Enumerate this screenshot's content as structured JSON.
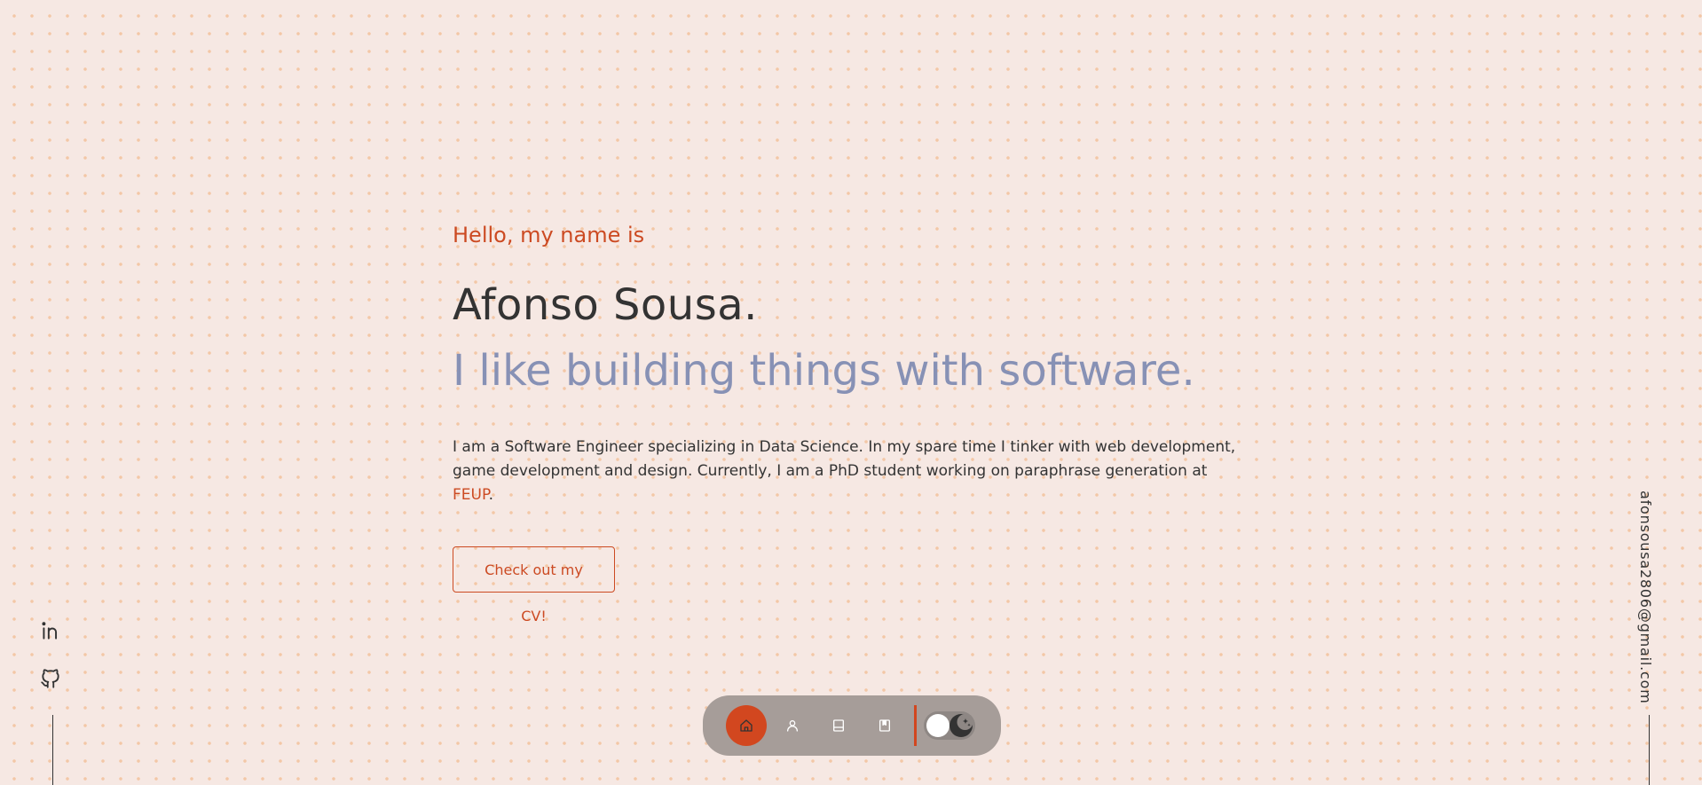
{
  "hero": {
    "greeting": "Hello, my name is",
    "name": "Afonso Sousa.",
    "tagline": "I like building things with software.",
    "bio_text": "I am a Software Engineer specializing in Data Science. In my spare time I tinker with web development, game development and design. Currently, I am a PhD student working on paraphrase generation at ",
    "bio_link": "FEUP",
    "bio_end": ".",
    "cv_button": "Check out my CV!"
  },
  "contact": {
    "email": "afonsousa2806@gmail.com"
  },
  "social": {
    "icons": [
      "linkedin-icon",
      "github-icon"
    ]
  },
  "nav": {
    "items": [
      "home-icon",
      "user-icon",
      "projects-icon",
      "blog-icon"
    ],
    "active": "home-icon",
    "theme_toggle_icon": "moon-icon"
  },
  "colors": {
    "accent": "#cc4a22",
    "tagline": "#8791b5",
    "background": "#f6e8e3",
    "dots": "#f3c7a6",
    "navbar": "#a69d99"
  }
}
